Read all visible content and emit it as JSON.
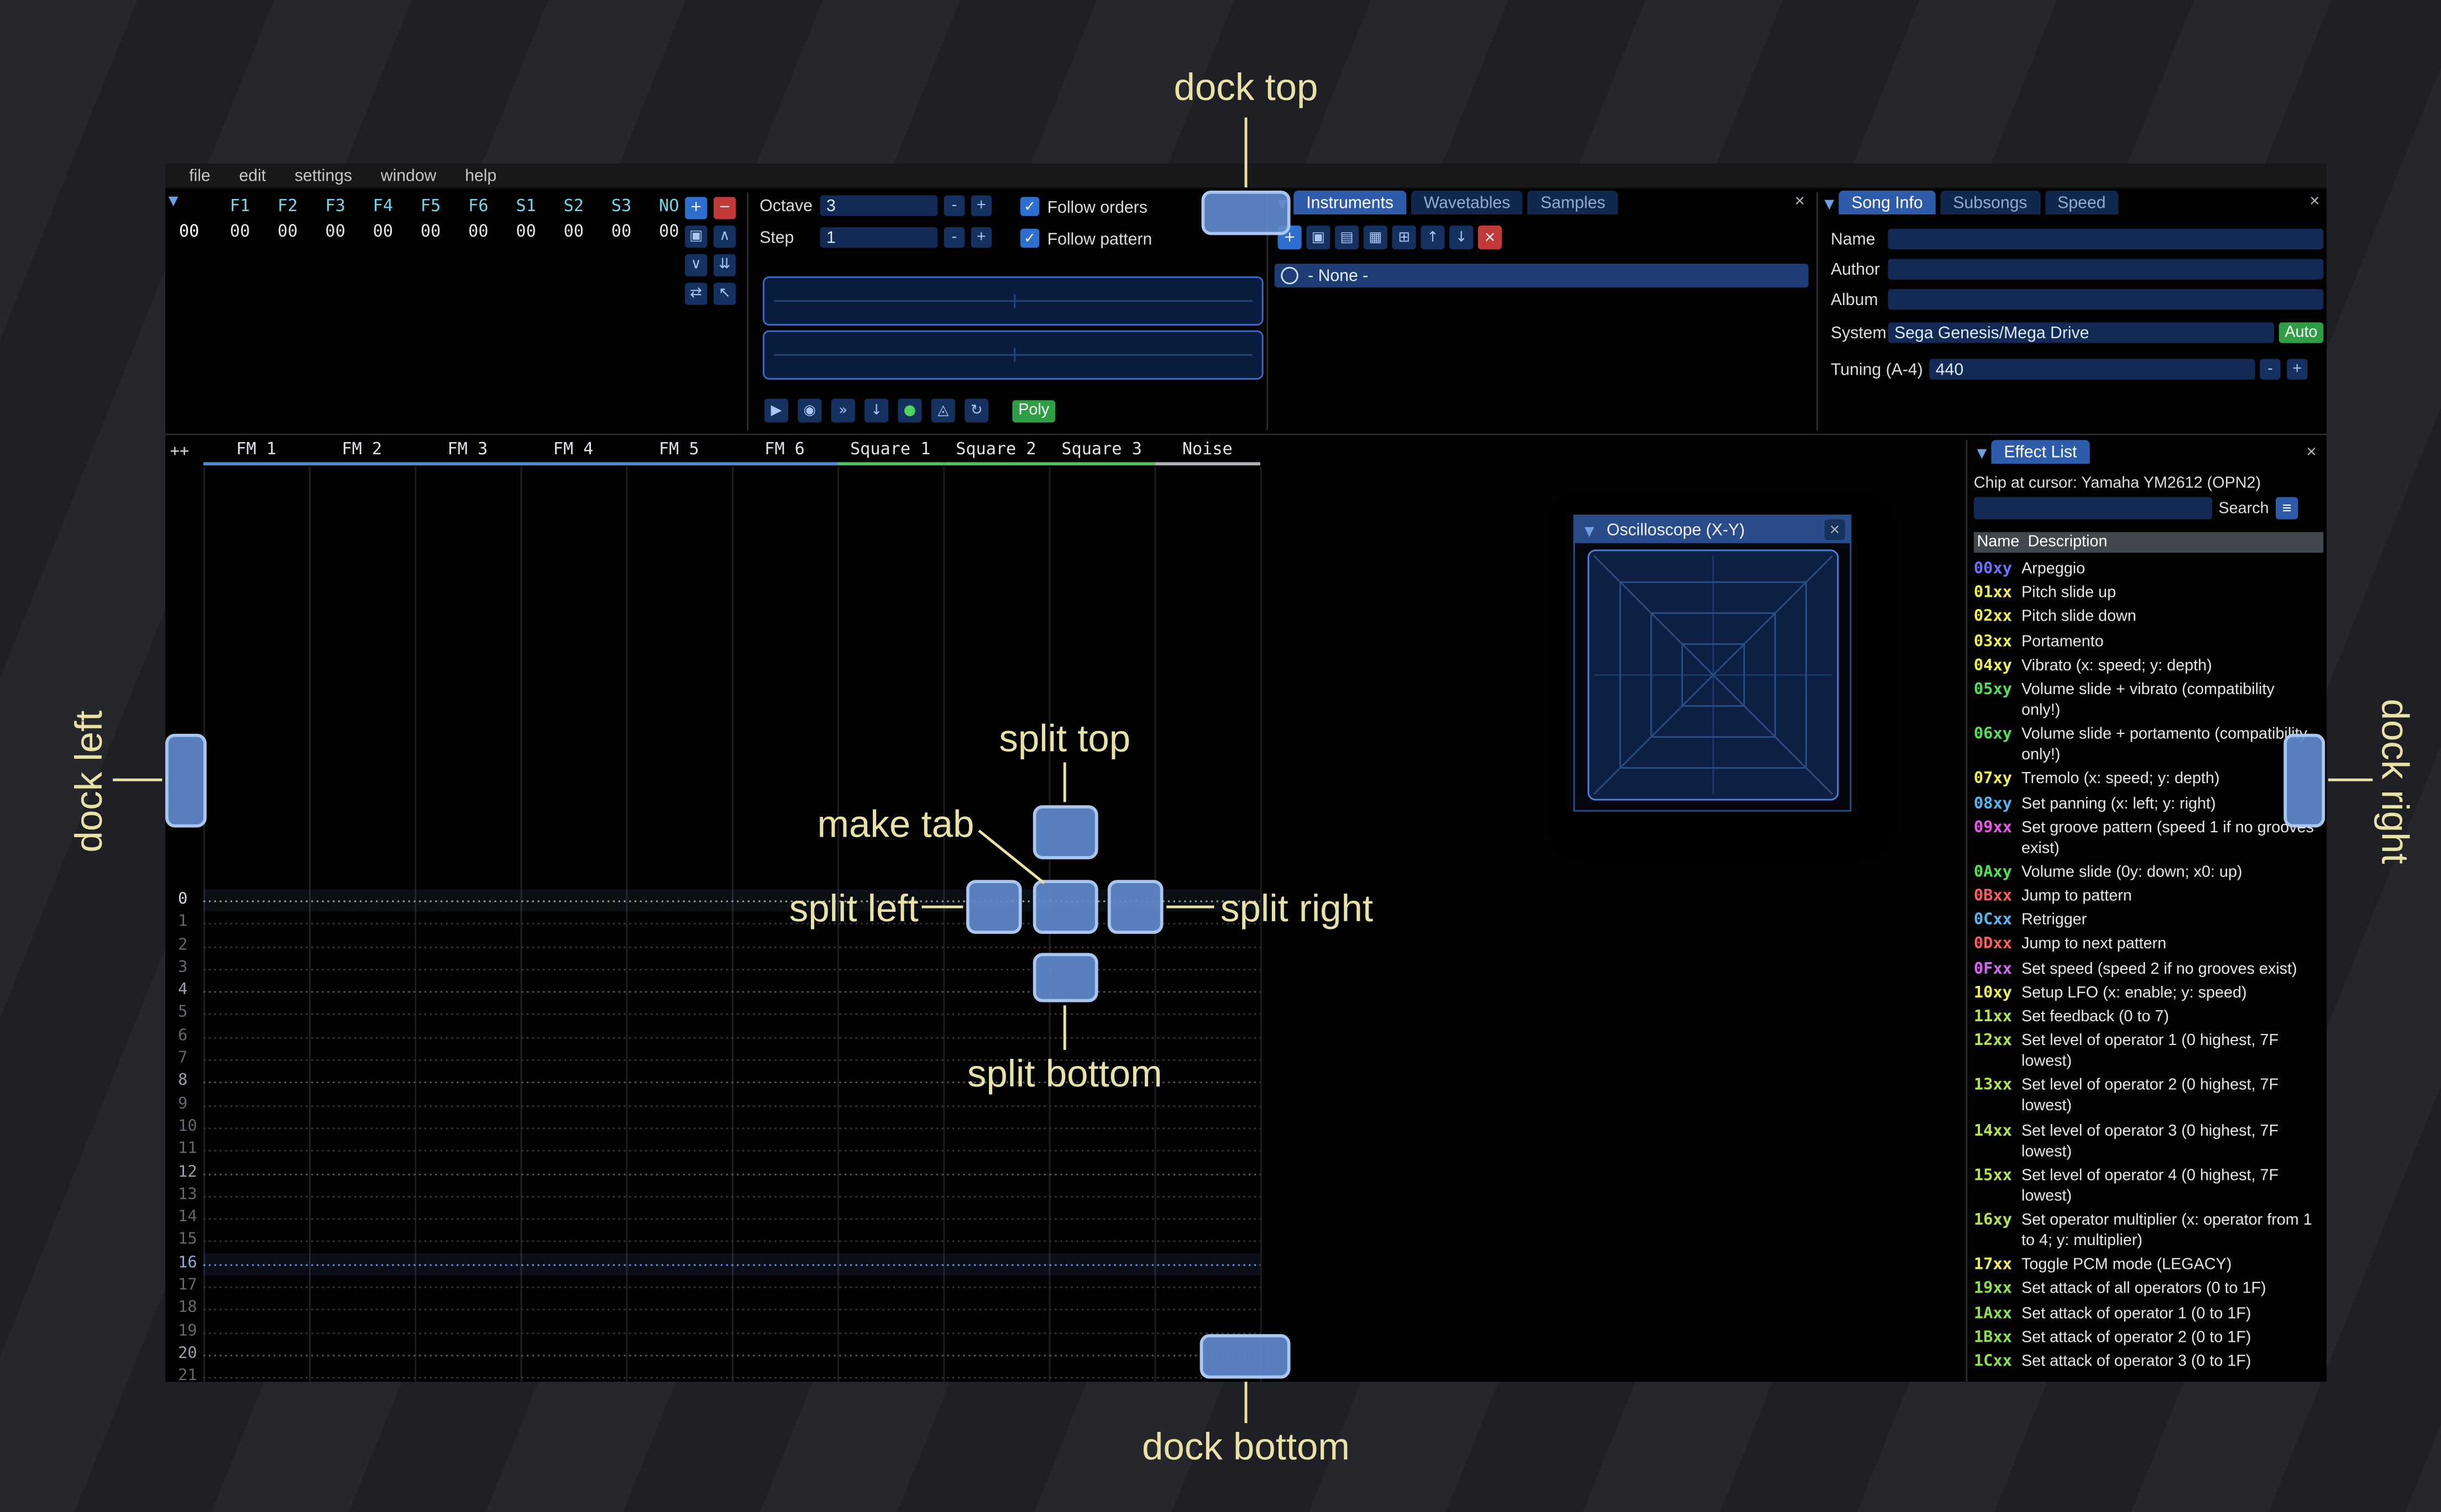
{
  "icons": {
    "collapse": "▼",
    "close": "×",
    "hamburger": "≡",
    "check": "✓"
  },
  "menu": {
    "items": [
      {
        "name": "menu-file",
        "label": "file"
      },
      {
        "name": "menu-edit",
        "label": "edit"
      },
      {
        "name": "menu-settings",
        "label": "settings"
      },
      {
        "name": "menu-window",
        "label": "window"
      },
      {
        "name": "menu-help",
        "label": "help"
      }
    ]
  },
  "orders": {
    "row_index": "00",
    "headers": [
      {
        "label": "F1"
      },
      {
        "label": "F2"
      },
      {
        "label": "F3"
      },
      {
        "label": "F4"
      },
      {
        "label": "F5"
      },
      {
        "label": "F6"
      },
      {
        "label": "S1"
      },
      {
        "label": "S2"
      },
      {
        "label": "S3"
      },
      {
        "label": "NO"
      }
    ],
    "cells": [
      {
        "v": "00"
      },
      {
        "v": "00"
      },
      {
        "v": "00"
      },
      {
        "v": "00"
      },
      {
        "v": "00"
      },
      {
        "v": "00"
      },
      {
        "v": "00"
      },
      {
        "v": "00"
      },
      {
        "v": "00"
      },
      {
        "v": "00"
      }
    ],
    "buttons": [
      {
        "name": "order-add-button",
        "glyph": "+",
        "cls": "primary"
      },
      {
        "name": "order-remove-button",
        "glyph": "−",
        "cls": "danger"
      },
      {
        "name": "order-duplicate-button",
        "glyph": "▣",
        "cls": ""
      },
      {
        "name": "order-move-up-button",
        "glyph": "∧",
        "cls": ""
      },
      {
        "name": "order-move-down-button",
        "glyph": "∨",
        "cls": ""
      },
      {
        "name": "order-duplicate-end-button",
        "glyph": "⇊",
        "cls": ""
      },
      {
        "name": "order-change-all-button",
        "glyph": "⇄",
        "cls": ""
      },
      {
        "name": "order-edit-mode-button",
        "glyph": "↖",
        "cls": ""
      }
    ]
  },
  "transport": {
    "octave_label": "Octave",
    "octave_value": "3",
    "step_label": "Step",
    "step_value": "1",
    "minus": "-",
    "plus": "+",
    "follow_orders": "Follow orders",
    "follow_pattern": "Follow pattern",
    "poly": "Poly",
    "buttons": [
      {
        "name": "play-button",
        "glyph": "▶"
      },
      {
        "name": "stop-button",
        "glyph": "◉"
      },
      {
        "name": "play-pattern-button",
        "glyph": "»"
      },
      {
        "name": "step-row-button",
        "glyph": "↓"
      },
      {
        "name": "record-button",
        "glyph": "●",
        "color": "#4fd45f"
      },
      {
        "name": "metronome-button",
        "glyph": "◬"
      },
      {
        "name": "repeat-pattern-button",
        "glyph": "↻"
      }
    ]
  },
  "instruments": {
    "tabs": [
      {
        "name": "tab-instruments",
        "label": "Instruments",
        "state": "sel"
      },
      {
        "name": "tab-wavetables",
        "label": "Wavetables",
        "state": ""
      },
      {
        "name": "tab-samples",
        "label": "Samples",
        "state": ""
      }
    ],
    "toolbar": [
      {
        "name": "instrument-add-button",
        "glyph": "+",
        "cls": "primary"
      },
      {
        "name": "instrument-duplicate-button",
        "glyph": "▣",
        "cls": ""
      },
      {
        "name": "instrument-open-button",
        "glyph": "▤",
        "cls": ""
      },
      {
        "name": "instrument-save-button",
        "glyph": "▦",
        "cls": ""
      },
      {
        "name": "instrument-folder-button",
        "glyph": "⊞",
        "cls": ""
      },
      {
        "name": "instrument-move-up-button",
        "glyph": "↑",
        "cls": ""
      },
      {
        "name": "instrument-move-down-button",
        "glyph": "↓",
        "cls": ""
      },
      {
        "name": "instrument-delete-button",
        "glyph": "×",
        "cls": "danger"
      }
    ],
    "list": [
      {
        "label": "- None -"
      }
    ]
  },
  "song_info": {
    "tabs": [
      {
        "name": "tab-song-info",
        "label": "Song Info",
        "state": "sel"
      },
      {
        "name": "tab-subsongs",
        "label": "Subsongs",
        "state": ""
      },
      {
        "name": "tab-speed",
        "label": "Speed",
        "state": ""
      }
    ],
    "name_label": "Name",
    "name_value": "",
    "author_label": "Author",
    "author_value": "",
    "album_label": "Album",
    "album_value": "",
    "system_label": "System",
    "system_value": "Sega Genesis/Mega Drive",
    "auto": "Auto",
    "tuning_label": "Tuning (A-4)",
    "tuning_value": "440",
    "minus": "-",
    "plus": "+"
  },
  "pattern": {
    "corner": "++",
    "channels": [
      {
        "name": "FM 1",
        "type": "fm"
      },
      {
        "name": "FM 2",
        "type": "fm"
      },
      {
        "name": "FM 3",
        "type": "fm"
      },
      {
        "name": "FM 4",
        "type": "fm"
      },
      {
        "name": "FM 5",
        "type": "fm"
      },
      {
        "name": "FM 6",
        "type": "fm"
      },
      {
        "name": "Square 1",
        "type": "sq"
      },
      {
        "name": "Square 2",
        "type": "sq"
      },
      {
        "name": "Square 3",
        "type": "sq"
      },
      {
        "name": "Noise",
        "type": "noise"
      }
    ],
    "rows": [
      {
        "n": "0",
        "k": "cur"
      },
      {
        "n": "1",
        "k": "min"
      },
      {
        "n": "2",
        "k": "min"
      },
      {
        "n": "3",
        "k": "min"
      },
      {
        "n": "4",
        "k": "maj"
      },
      {
        "n": "5",
        "k": "min"
      },
      {
        "n": "6",
        "k": "min"
      },
      {
        "n": "7",
        "k": "min"
      },
      {
        "n": "8",
        "k": "maj"
      },
      {
        "n": "9",
        "k": "min"
      },
      {
        "n": "10",
        "k": "min"
      },
      {
        "n": "11",
        "k": "min"
      },
      {
        "n": "12",
        "k": "maj"
      },
      {
        "n": "13",
        "k": "min"
      },
      {
        "n": "14",
        "k": "min"
      },
      {
        "n": "15",
        "k": "min"
      },
      {
        "n": "16",
        "k": "blue"
      },
      {
        "n": "17",
        "k": "min"
      },
      {
        "n": "18",
        "k": "min"
      },
      {
        "n": "19",
        "k": "min"
      },
      {
        "n": "20",
        "k": "maj"
      },
      {
        "n": "21",
        "k": "min"
      }
    ]
  },
  "oscilloscope": {
    "title": "Oscilloscope (X-Y)"
  },
  "effect_list": {
    "tab": "Effect List",
    "chip": "Chip at cursor: Yamaha YM2612 (OPN2)",
    "search_label": "Search",
    "col_name": "Name",
    "col_desc": "Description",
    "rows": [
      {
        "name": "00xy",
        "desc": "Arpeggio",
        "color": "#6a74ff"
      },
      {
        "name": "01xx",
        "desc": "Pitch slide up",
        "color": "#f0f055"
      },
      {
        "name": "02xx",
        "desc": "Pitch slide down",
        "color": "#f0f055"
      },
      {
        "name": "03xx",
        "desc": "Portamento",
        "color": "#f0f055"
      },
      {
        "name": "04xy",
        "desc": "Vibrato (x: speed; y: depth)",
        "color": "#f0f055"
      },
      {
        "name": "05xy",
        "desc": "Volume slide + vibrato (compatibility only!)",
        "color": "#55e055"
      },
      {
        "name": "06xy",
        "desc": "Volume slide + portamento (compatibility only!)",
        "color": "#55e055"
      },
      {
        "name": "07xy",
        "desc": "Tremolo (x: speed; y: depth)",
        "color": "#f0f055"
      },
      {
        "name": "08xy",
        "desc": "Set panning (x: left; y: right)",
        "color": "#55b8f0"
      },
      {
        "name": "09xx",
        "desc": "Set groove pattern (speed 1 if no grooves exist)",
        "color": "#ee58ee"
      },
      {
        "name": "0Axy",
        "desc": "Volume slide (0y: down; x0: up)",
        "color": "#55e055"
      },
      {
        "name": "0Bxx",
        "desc": "Jump to pattern",
        "color": "#ff5c5c"
      },
      {
        "name": "0Cxx",
        "desc": "Retrigger",
        "color": "#55b8f0"
      },
      {
        "name": "0Dxx",
        "desc": "Jump to next pattern",
        "color": "#ff5c5c"
      },
      {
        "name": "0Fxx",
        "desc": "Set speed (speed 2 if no grooves exist)",
        "color": "#d864f8"
      },
      {
        "name": "10xy",
        "desc": "Setup LFO (x: enable; y: speed)",
        "color": "#f0f055"
      },
      {
        "name": "11xx",
        "desc": "Set feedback (0 to 7)",
        "color": "#b2e44e"
      },
      {
        "name": "12xx",
        "desc": "Set level of operator 1 (0 highest, 7F lowest)",
        "color": "#b2e44e"
      },
      {
        "name": "13xx",
        "desc": "Set level of operator 2 (0 highest, 7F lowest)",
        "color": "#b2e44e"
      },
      {
        "name": "14xx",
        "desc": "Set level of operator 3 (0 highest, 7F lowest)",
        "color": "#b2e44e"
      },
      {
        "name": "15xx",
        "desc": "Set level of operator 4 (0 highest, 7F lowest)",
        "color": "#b2e44e"
      },
      {
        "name": "16xy",
        "desc": "Set operator multiplier (x: operator from 1 to 4; y: multiplier)",
        "color": "#b2e44e"
      },
      {
        "name": "17xx",
        "desc": "Toggle PCM mode (LEGACY)",
        "color": "#f0f055"
      },
      {
        "name": "19xx",
        "desc": "Set attack of all operators (0 to 1F)",
        "color": "#8fe050"
      },
      {
        "name": "1Axx",
        "desc": "Set attack of operator 1 (0 to 1F)",
        "color": "#8fe050"
      },
      {
        "name": "1Bxx",
        "desc": "Set attack of operator 2 (0 to 1F)",
        "color": "#8fe050"
      },
      {
        "name": "1Cxx",
        "desc": "Set attack of operator 3 (0 to 1F)",
        "color": "#8fe050"
      }
    ]
  },
  "docks": [
    {
      "name": "dock-top-indicator",
      "cls": "d-top"
    },
    {
      "name": "dock-bottom-indicator",
      "cls": "d-bottom"
    },
    {
      "name": "dock-left-indicator",
      "cls": "d-left"
    },
    {
      "name": "dock-right-indicator",
      "cls": "d-right"
    },
    {
      "name": "split-top-indicator",
      "cls": "d-stop"
    },
    {
      "name": "make-tab-indicator",
      "cls": "d-mtab"
    },
    {
      "name": "split-left-indicator",
      "cls": "d-sleft"
    },
    {
      "name": "split-right-indicator",
      "cls": "d-sright"
    },
    {
      "name": "split-bottom-indicator",
      "cls": "d-sbottom"
    }
  ],
  "labels": [
    {
      "name": "dock-top-label",
      "cls": "l-top",
      "text": "dock top"
    },
    {
      "name": "dock-bottom-label",
      "cls": "l-bottom",
      "text": "dock bottom"
    },
    {
      "name": "dock-left-label",
      "cls": "l-left",
      "text": "dock left"
    },
    {
      "name": "dock-right-label",
      "cls": "l-right",
      "text": "dock right"
    },
    {
      "name": "split-top-label",
      "cls": "l-stop",
      "text": "split top"
    },
    {
      "name": "split-bottom-label",
      "cls": "l-sbottom",
      "text": "split bottom"
    },
    {
      "name": "split-left-label",
      "cls": "l-sleft",
      "text": "split left"
    },
    {
      "name": "split-right-label",
      "cls": "l-sright",
      "text": "split right"
    },
    {
      "name": "make-tab-label",
      "cls": "l-mtab",
      "text": "make tab"
    }
  ]
}
